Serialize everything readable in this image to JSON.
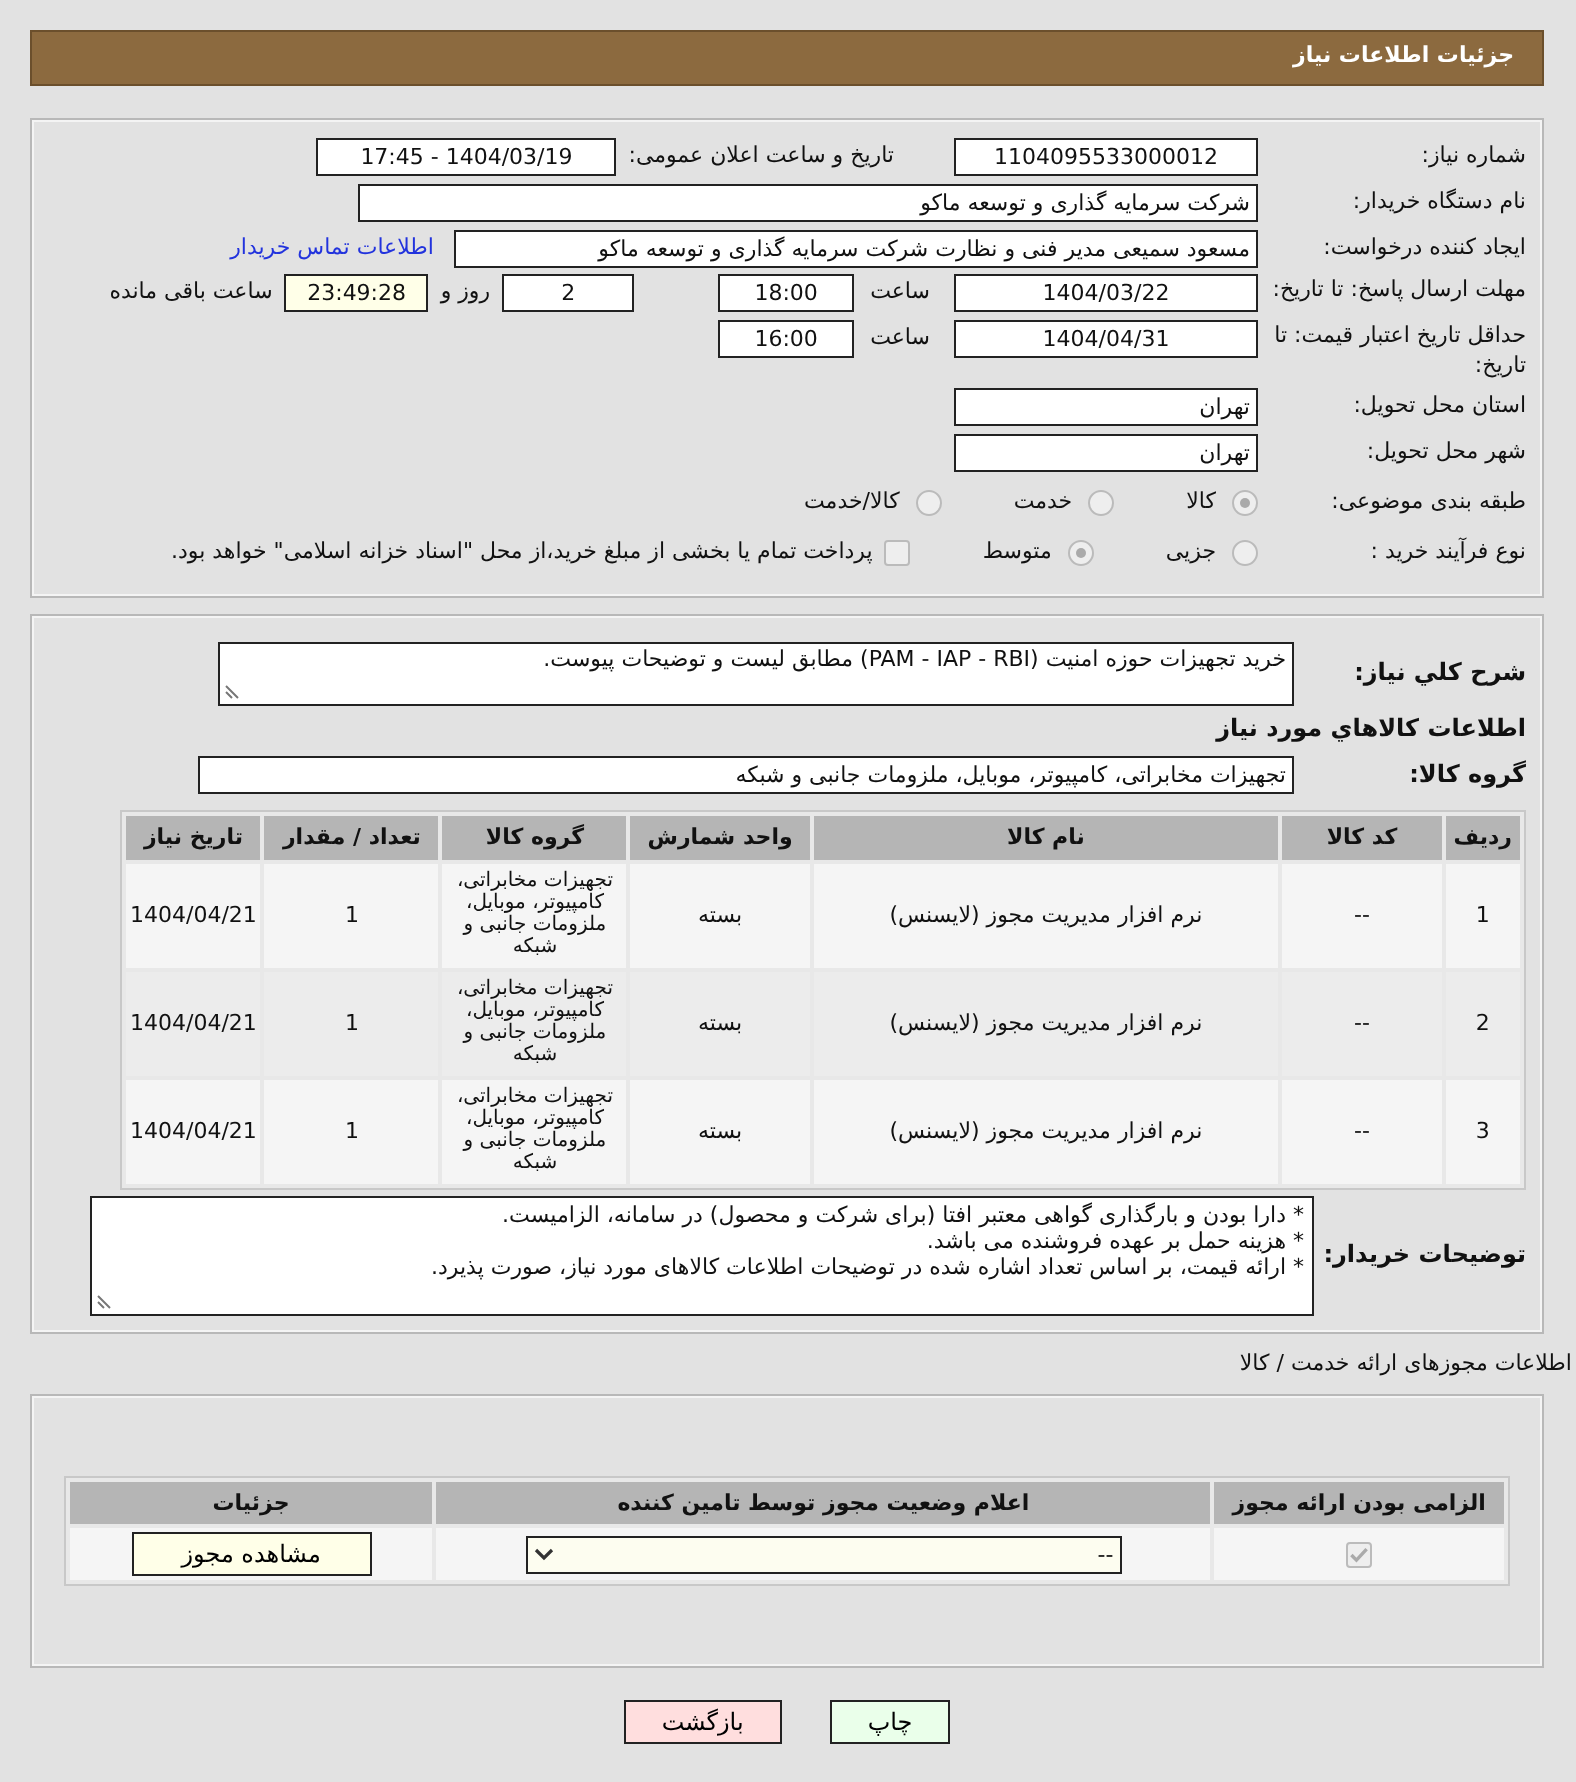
{
  "header": {
    "title": "جزئیات اطلاعات نیاز"
  },
  "need_number": {
    "label": "شماره نیاز:",
    "value": "1104095533000012"
  },
  "announce": {
    "label": "تاریخ و ساعت اعلان عمومی:",
    "value": "1404/03/19 - 17:45"
  },
  "buyer_org": {
    "label": "نام دستگاه خریدار:",
    "value": "شرکت سرمایه گذاری و توسعه ماکو"
  },
  "requester": {
    "label": "ایجاد کننده درخواست:",
    "value": "مسعود سمیعی مدیر فنی و نظارت   شرکت سرمایه گذاری و توسعه ماکو",
    "link": "اطلاعات تماس خریدار"
  },
  "deadline": {
    "label": "مهلت ارسال پاسخ: تا تاریخ:",
    "date": "1404/03/22",
    "time_label": "ساعت",
    "time": "18:00",
    "days": "2",
    "days_label": "روز و",
    "remaining": "23:49:28",
    "remaining_label": "ساعت باقی مانده"
  },
  "validity": {
    "label": "حداقل تاریخ اعتبار قیمت: تا تاریخ:",
    "date": "1404/04/31",
    "time_label": "ساعت",
    "time": "16:00"
  },
  "province": {
    "label": "استان محل تحویل:",
    "value": "تهران"
  },
  "city": {
    "label": "شهر محل تحویل:",
    "value": "تهران"
  },
  "category": {
    "label": "طبقه بندی موضوعی:",
    "options": [
      {
        "label": "کالا",
        "selected": true
      },
      {
        "label": "خدمت",
        "selected": false
      },
      {
        "label": "کالا/خدمت",
        "selected": false
      }
    ]
  },
  "purchase_type": {
    "label": "نوع فرآیند خرید :",
    "options": [
      {
        "label": "جزیی",
        "selected": false
      },
      {
        "label": "متوسط",
        "selected": true
      }
    ],
    "checkbox": {
      "label": "پرداخت تمام یا بخشی از مبلغ خرید،از محل \"اسناد خزانه اسلامی\" خواهد بود.",
      "checked": false
    }
  },
  "description": {
    "label": "شرح كلي نياز:",
    "value": "خرید تجهیزات حوزه امنیت (PAM - IAP - RBI) مطابق لیست و توضیحات پیوست."
  },
  "goods_title": "اطلاعات كالاهاي مورد نياز",
  "goods_group": {
    "label": "گروه کالا:",
    "value": "تجهیزات مخابراتی، کامپیوتر، موبایل، ملزومات جانبی و شبکه"
  },
  "goods_table": {
    "columns": [
      "ردیف",
      "کد کالا",
      "نام کالا",
      "واحد شمارش",
      "گروه کالا",
      "تعداد / مقدار",
      "تاریخ نیاز"
    ],
    "rows": [
      [
        "1",
        "--",
        "نرم افزار مدیریت مجوز (لایسنس)",
        "بسته",
        "تجهیزات مخابراتی، کامپیوتر، موبایل، ملزومات جانبی و شبکه",
        "1",
        "1404/04/21"
      ],
      [
        "2",
        "--",
        "نرم افزار مدیریت مجوز (لایسنس)",
        "بسته",
        "تجهیزات مخابراتی، کامپیوتر، موبایل، ملزومات جانبی و شبکه",
        "1",
        "1404/04/21"
      ],
      [
        "3",
        "--",
        "نرم افزار مدیریت مجوز (لایسنس)",
        "بسته",
        "تجهیزات مخابراتی، کامپیوتر، موبایل، ملزومات جانبی و شبکه",
        "1",
        "1404/04/21"
      ]
    ]
  },
  "buyer_notes": {
    "label": "توضیحات خریدار:",
    "lines": [
      "* دارا بودن و بارگذاری گواهی معتبر افتا (برای شرکت و محصول) در سامانه، الزامیست.",
      "* هزینه حمل بر عهده فروشنده می باشد.",
      "* ارائه قیمت، بر اساس تعداد اشاره شده در توضیحات اطلاعات کالاهای مورد نیاز، صورت پذیرد."
    ]
  },
  "licenses_title": "اطلاعات مجوزهای ارائه خدمت / کالا",
  "license_table": {
    "columns": [
      "الزامی بودن ارائه مجوز",
      "اعلام وضعیت مجوز توسط تامین کننده",
      "جزئیات"
    ],
    "rows": [
      {
        "required": true,
        "status": "--",
        "button": "مشاهده مجوز"
      }
    ]
  },
  "buttons": [
    {
      "label": "چاپ",
      "kind": "print"
    },
    {
      "label": "بازگشت",
      "kind": "back"
    }
  ]
}
